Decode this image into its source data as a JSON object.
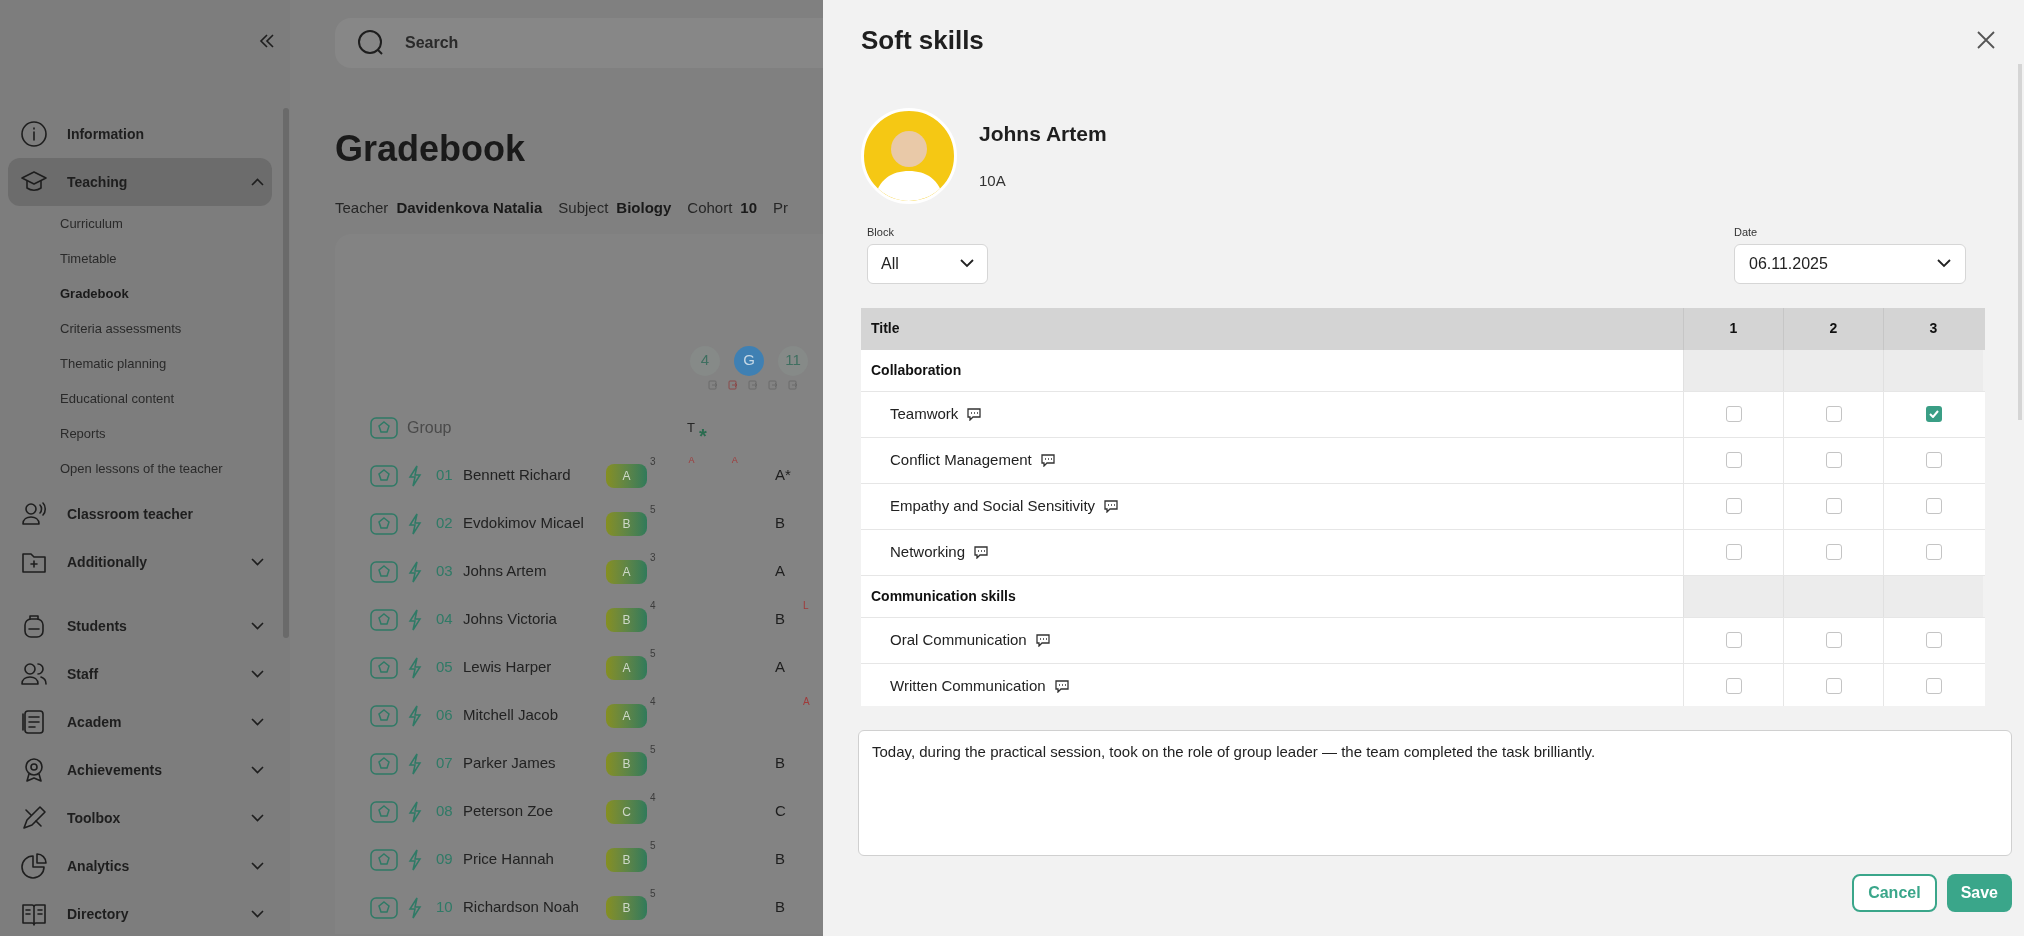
{
  "sidebar": {
    "items": [
      {
        "label": "Information",
        "selected": false
      },
      {
        "label": "Teaching",
        "selected": true,
        "expanded": true,
        "children": [
          {
            "label": "Curriculum",
            "selected": false
          },
          {
            "label": "Timetable",
            "selected": false
          },
          {
            "label": "Gradebook",
            "selected": true
          },
          {
            "label": "Criteria assessments",
            "selected": false
          },
          {
            "label": "Thematic planning",
            "selected": false
          },
          {
            "label": "Educational content",
            "selected": false
          },
          {
            "label": "Reports",
            "selected": false
          },
          {
            "label": "Open lessons of the teacher",
            "selected": false
          }
        ]
      },
      {
        "label": "Classroom teacher",
        "selected": false
      },
      {
        "label": "Additionally",
        "selected": false,
        "expanded": false
      },
      {
        "label": "Students",
        "selected": false,
        "expanded": false
      },
      {
        "label": "Staff",
        "selected": false,
        "expanded": false
      },
      {
        "label": "Academ",
        "selected": false,
        "expanded": false
      },
      {
        "label": "Achievements",
        "selected": false,
        "expanded": false
      },
      {
        "label": "Toolbox",
        "selected": false,
        "expanded": false
      },
      {
        "label": "Analytics",
        "selected": false,
        "expanded": false
      },
      {
        "label": "Directory",
        "selected": false,
        "expanded": false
      }
    ]
  },
  "search": {
    "placeholder": "Search"
  },
  "page": {
    "title": "Gradebook",
    "meta": [
      {
        "label": "Teacher",
        "value": "Davidenkova Natalia"
      },
      {
        "label": "Subject",
        "value": "Biology"
      },
      {
        "label": "Cohort",
        "value": "10"
      },
      {
        "label": "Pr"
      }
    ]
  },
  "gradebook": {
    "lessons": [
      {
        "label": "4",
        "selected": false
      },
      {
        "label": "G",
        "selected": true
      },
      {
        "label": "11",
        "selected": false
      }
    ],
    "group_header": "Group",
    "final_header": "T",
    "final_mark": "*",
    "rows": [
      {
        "number": "01",
        "name": "Bennett Richard",
        "grade": "A",
        "count": "3",
        "marks": [
          "A",
          "A"
        ],
        "final": "A*"
      },
      {
        "number": "02",
        "name": "Evdokimov Micael",
        "grade": "B",
        "count": "5",
        "final": "B"
      },
      {
        "number": "03",
        "name": "Johns Artem",
        "grade": "A",
        "count": "3",
        "final": "A"
      },
      {
        "number": "04",
        "name": "Johns Victoria",
        "grade": "B",
        "count": "4",
        "final": "B",
        "side_mark": "L"
      },
      {
        "number": "05",
        "name": "Lewis Harper",
        "grade": "A",
        "count": "5",
        "final": "A"
      },
      {
        "number": "06",
        "name": "Mitchell Jacob",
        "grade": "A",
        "count": "4",
        "side_mark": "A"
      },
      {
        "number": "07",
        "name": "Parker James",
        "grade": "B",
        "count": "5",
        "final": "B"
      },
      {
        "number": "08",
        "name": "Peterson Zoe",
        "grade": "C",
        "count": "4",
        "final": "C"
      },
      {
        "number": "09",
        "name": "Price Hannah",
        "grade": "B",
        "count": "5",
        "final": "B"
      },
      {
        "number": "10",
        "name": "Richardson Noah",
        "grade": "B",
        "count": "5",
        "final": "B"
      }
    ]
  },
  "modal": {
    "title": "Soft skills",
    "student": {
      "name": "Johns Artem",
      "class": "10A"
    },
    "block": {
      "label": "Block",
      "value": "All"
    },
    "date": {
      "label": "Date",
      "value": "06.11.2025"
    },
    "table": {
      "columns": [
        "Title",
        "1",
        "2",
        "3"
      ],
      "rows": [
        {
          "kind": "group",
          "title": "Collaboration"
        },
        {
          "kind": "skill",
          "title": "Teamwork",
          "checks": [
            false,
            false,
            true
          ]
        },
        {
          "kind": "skill",
          "title": "Conflict Management",
          "checks": [
            false,
            false,
            false
          ]
        },
        {
          "kind": "skill",
          "title": "Empathy and Social Sensitivity",
          "checks": [
            false,
            false,
            false
          ]
        },
        {
          "kind": "skill",
          "title": "Networking",
          "checks": [
            false,
            false,
            false
          ]
        },
        {
          "kind": "group",
          "title": "Communication skills"
        },
        {
          "kind": "skill",
          "title": "Oral Communication",
          "checks": [
            false,
            false,
            false
          ]
        },
        {
          "kind": "skill",
          "title": "Written Communication",
          "checks": [
            false,
            false,
            false
          ]
        }
      ]
    },
    "comment": "Today, during the practical session, took on the role of group leader — the team completed the task brilliantly.",
    "buttons": {
      "cancel": "Cancel",
      "save": "Save"
    }
  }
}
